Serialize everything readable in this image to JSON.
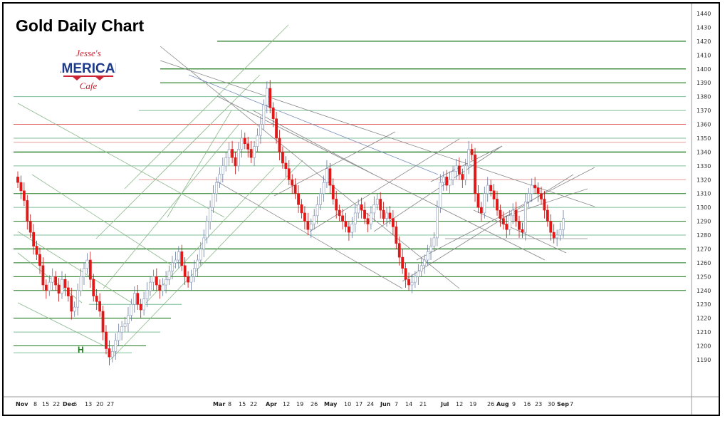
{
  "chart_data": {
    "type": "candlestick",
    "title": "Gold Daily Chart",
    "ylim": [
      1180,
      1445
    ],
    "y_ticks": [
      1190,
      1200,
      1210,
      1220,
      1230,
      1240,
      1250,
      1260,
      1270,
      1280,
      1290,
      1300,
      1310,
      1320,
      1330,
      1340,
      1350,
      1360,
      1370,
      1380,
      1390,
      1400,
      1410,
      1420,
      1430,
      1440
    ],
    "x_ticks": [
      {
        "label": "Nov",
        "bold": true
      },
      {
        "label": "8"
      },
      {
        "label": "15"
      },
      {
        "label": "22"
      },
      {
        "label": "Dec",
        "bold": true
      },
      {
        "label": "6"
      },
      {
        "label": "13"
      },
      {
        "label": "20"
      },
      {
        "label": "27"
      },
      {
        "label": "Mar",
        "bold": true
      },
      {
        "label": "8"
      },
      {
        "label": "15"
      },
      {
        "label": "22"
      },
      {
        "label": "Apr",
        "bold": true
      },
      {
        "label": "12"
      },
      {
        "label": "19"
      },
      {
        "label": "26"
      },
      {
        "label": "May",
        "bold": true
      },
      {
        "label": "10"
      },
      {
        "label": "17"
      },
      {
        "label": "24"
      },
      {
        "label": "Jun",
        "bold": true
      },
      {
        "label": "7"
      },
      {
        "label": "14"
      },
      {
        "label": "21"
      },
      {
        "label": "Jul",
        "bold": true
      },
      {
        "label": "12"
      },
      {
        "label": "19"
      },
      {
        "label": "26"
      },
      {
        "label": "Aug",
        "bold": true
      },
      {
        "label": "9"
      },
      {
        "label": "16"
      },
      {
        "label": "23"
      },
      {
        "label": "30"
      },
      {
        "label": "Sep",
        "bold": true
      },
      {
        "label": "7"
      }
    ],
    "closes": [
      1318,
      1312,
      1305,
      1290,
      1282,
      1272,
      1266,
      1258,
      1244,
      1240,
      1246,
      1250,
      1244,
      1238,
      1248,
      1242,
      1236,
      1225,
      1228,
      1240,
      1250,
      1256,
      1262,
      1248,
      1236,
      1232,
      1225,
      1210,
      1198,
      1192,
      1196,
      1204,
      1210,
      1214,
      1216,
      1222,
      1230,
      1238,
      1230,
      1226,
      1234,
      1240,
      1246,
      1250,
      1244,
      1240,
      1244,
      1248,
      1254,
      1260,
      1262,
      1268,
      1258,
      1250,
      1246,
      1250,
      1256,
      1262,
      1270,
      1278,
      1290,
      1300,
      1310,
      1318,
      1324,
      1330,
      1336,
      1342,
      1336,
      1330,
      1342,
      1350,
      1346,
      1342,
      1336,
      1344,
      1352,
      1360,
      1374,
      1386,
      1372,
      1364,
      1350,
      1340,
      1332,
      1328,
      1320,
      1316,
      1310,
      1302,
      1296,
      1290,
      1284,
      1288,
      1294,
      1302,
      1310,
      1318,
      1328,
      1316,
      1306,
      1298,
      1294,
      1290,
      1286,
      1282,
      1288,
      1296,
      1302,
      1298,
      1292,
      1288,
      1296,
      1302,
      1306,
      1298,
      1292,
      1296,
      1292,
      1286,
      1274,
      1264,
      1256,
      1248,
      1244,
      1246,
      1250,
      1254,
      1258,
      1262,
      1268,
      1272,
      1278,
      1300,
      1318,
      1322,
      1316,
      1320,
      1326,
      1330,
      1324,
      1320,
      1330,
      1342,
      1338,
      1310,
      1300,
      1296,
      1310,
      1316,
      1312,
      1306,
      1298,
      1292,
      1288,
      1284,
      1294,
      1298,
      1290,
      1284,
      1282,
      1304,
      1310,
      1316,
      1314,
      1310,
      1306,
      1298,
      1290,
      1282,
      1278,
      1280,
      1284,
      1292
    ]
  }
}
